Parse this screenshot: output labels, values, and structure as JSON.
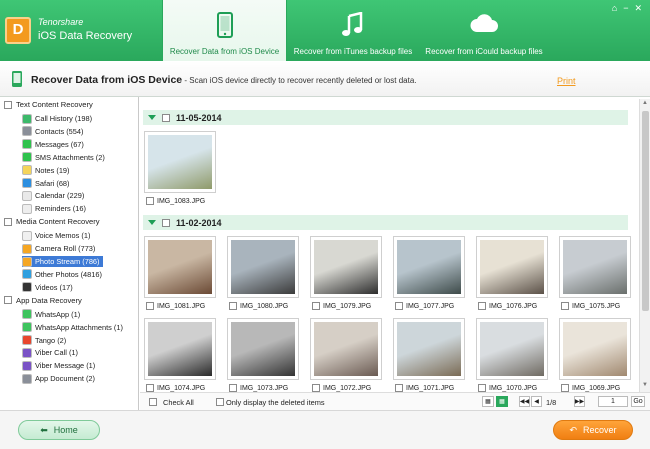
{
  "app": {
    "vendor": "Tenorshare",
    "name": "iOS Data Recovery",
    "logo_letter": "D"
  },
  "tabs": [
    {
      "label": "Recover Data from iOS Device",
      "icon": "phone-icon",
      "active": true
    },
    {
      "label": "Recover from iTunes backup files",
      "icon": "music-note-icon",
      "active": false
    },
    {
      "label": "Recover from iCould backup files",
      "icon": "cloud-icon",
      "active": false
    }
  ],
  "window_controls": [
    "home-icon",
    "minimize-icon",
    "close-icon"
  ],
  "subheader": {
    "title": "Recover Data from iOS Device",
    "desc": " - Scan iOS device directly to recover recently deleted or lost data.",
    "print": "Print"
  },
  "sidebar": {
    "groups": [
      {
        "label": "Text Content Recovery",
        "items": [
          {
            "label": "Call History (198)",
            "icon": "call-history-icon",
            "color": "#3cb96a"
          },
          {
            "label": "Contacts (554)",
            "icon": "contacts-icon",
            "color": "#8a8f99"
          },
          {
            "label": "Messages (67)",
            "icon": "messages-icon",
            "color": "#2fc34d"
          },
          {
            "label": "SMS Attachments (2)",
            "icon": "sms-attachments-icon",
            "color": "#2fc34d"
          },
          {
            "label": "Notes (19)",
            "icon": "notes-icon",
            "color": "#f4d45a"
          },
          {
            "label": "Safari (68)",
            "icon": "safari-icon",
            "color": "#2d8fe0"
          },
          {
            "label": "Calendar (229)",
            "icon": "calendar-icon",
            "color": "#e9e9e9"
          },
          {
            "label": "Reminders (16)",
            "icon": "reminders-icon",
            "color": "#eeeeee"
          }
        ]
      },
      {
        "label": "Media Content Recovery",
        "items": [
          {
            "label": "Voice Memos (1)",
            "icon": "voice-memos-icon",
            "color": "#f0f0f0"
          },
          {
            "label": "Camera Roll (773)",
            "icon": "camera-roll-icon",
            "color": "#f5a623"
          },
          {
            "label": "Photo Stream (786)",
            "icon": "photo-stream-icon",
            "color": "#f5a623",
            "selected": true
          },
          {
            "label": "Other Photos (4816)",
            "icon": "other-photos-icon",
            "color": "#2fa0e0"
          },
          {
            "label": "Videos (17)",
            "icon": "videos-icon",
            "color": "#333333"
          }
        ]
      },
      {
        "label": "App Data Recovery",
        "items": [
          {
            "label": "WhatsApp (1)",
            "icon": "whatsapp-icon",
            "color": "#3ec45e"
          },
          {
            "label": "WhatsApp Attachments (1)",
            "icon": "whatsapp-attachments-icon",
            "color": "#3ec45e"
          },
          {
            "label": "Tango (2)",
            "icon": "tango-icon",
            "color": "#e8462d"
          },
          {
            "label": "Viber Call (1)",
            "icon": "viber-call-icon",
            "color": "#7a52c6"
          },
          {
            "label": "Viber Message (1)",
            "icon": "viber-message-icon",
            "color": "#7a52c6"
          },
          {
            "label": "App Document (2)",
            "icon": "app-document-icon",
            "color": "#8a8f99"
          }
        ]
      }
    ]
  },
  "groups": [
    {
      "date": "11-05-2014",
      "photos": [
        {
          "name": "IMG_1083.JPG",
          "tone": [
            "#d6e4ea",
            "#8f9a6a"
          ]
        }
      ]
    },
    {
      "date": "11-02-2014",
      "photos": [
        {
          "name": "IMG_1081.JPG",
          "tone": [
            "#c9b7a3",
            "#6b4a35"
          ]
        },
        {
          "name": "IMG_1080.JPG",
          "tone": [
            "#a9b4bd",
            "#3b3b3b"
          ]
        },
        {
          "name": "IMG_1079.JPG",
          "tone": [
            "#d8d8d2",
            "#2d2d2d"
          ]
        },
        {
          "name": "IMG_1077.JPG",
          "tone": [
            "#b7c4cc",
            "#3e4b4a"
          ]
        },
        {
          "name": "IMG_1076.JPG",
          "tone": [
            "#e7e1d4",
            "#5b5148"
          ]
        },
        {
          "name": "IMG_1075.JPG",
          "tone": [
            "#c7ccd1",
            "#6a6f6c"
          ]
        },
        {
          "name": "IMG_1074.JPG",
          "tone": [
            "#cfcfcf",
            "#2a2a2a"
          ]
        },
        {
          "name": "IMG_1073.JPG",
          "tone": [
            "#b8b8b8",
            "#333333"
          ]
        },
        {
          "name": "IMG_1072.JPG",
          "tone": [
            "#d6cfc6",
            "#6a5a52"
          ]
        },
        {
          "name": "IMG_1071.JPG",
          "tone": [
            "#cdd6da",
            "#7a6b55"
          ]
        },
        {
          "name": "IMG_1070.JPG",
          "tone": [
            "#d9dde0",
            "#6f6a62"
          ]
        },
        {
          "name": "IMG_1069.JPG",
          "tone": [
            "#eae4da",
            "#a0886f"
          ]
        }
      ]
    }
  ],
  "footer": {
    "check_all": "Check All",
    "only_deleted": "Only display the deleted items",
    "page": "1/8",
    "page_input": "1",
    "go": "Go"
  },
  "bottom": {
    "home": "Home",
    "recover": "Recover"
  }
}
